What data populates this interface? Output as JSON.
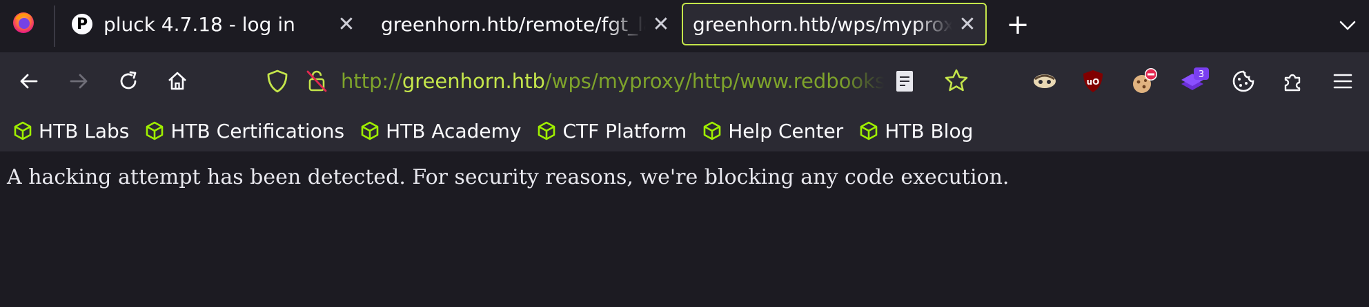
{
  "tabs": [
    {
      "favicon_letter": "P",
      "title": "pluck 4.7.18 - log in",
      "close": "✕"
    },
    {
      "title": "greenhorn.htb/remote/fgt_lang?lang=/../../../..//////////dev/",
      "close": "✕"
    },
    {
      "title": "greenhorn.htb/wps/myproxy/http/www.redbooks.ibm.com",
      "close": "✕",
      "active": true
    }
  ],
  "new_tab_label": "+",
  "urlbar": {
    "scheme": "http://",
    "host": "greenhorn.htb",
    "path": "/wps/myproxy/http/www.redbooks.ibm.com"
  },
  "extensions": [
    {
      "icon": "sneaky-extension-icon"
    },
    {
      "icon": "ublock-origin-icon",
      "label": "uO"
    },
    {
      "icon": "cookie-blocker-icon"
    },
    {
      "icon": "wappalyzer-icon",
      "badge": "3"
    },
    {
      "icon": "cookie-editor-icon"
    }
  ],
  "bookmarks": [
    {
      "label": "HTB Labs"
    },
    {
      "label": "HTB Certifications"
    },
    {
      "label": "HTB Academy"
    },
    {
      "label": "CTF Platform"
    },
    {
      "label": "Help Center"
    },
    {
      "label": "HTB Blog"
    }
  ],
  "content": {
    "message": "A hacking attempt has been detected. For security reasons, we're blocking any code execution."
  },
  "colors": {
    "accent": "#c5e64b",
    "url_dim": "#7ea32b",
    "background": "#1c1b22",
    "toolbar": "#2b2a33"
  }
}
